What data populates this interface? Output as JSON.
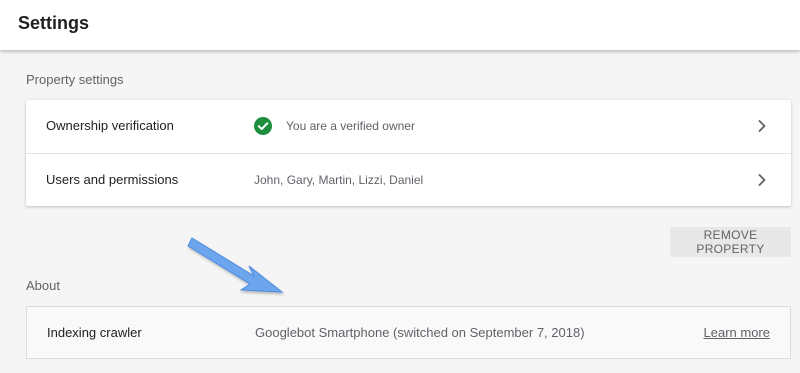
{
  "header": {
    "title": "Settings"
  },
  "property_settings": {
    "section_label": "Property settings",
    "rows": [
      {
        "title": "Ownership verification",
        "value": "You are a verified owner",
        "icon": "check-circle-icon",
        "icon_color": "#1e8e3e"
      },
      {
        "title": "Users and permissions",
        "value": "John, Gary, Martin, Lizzi, Daniel"
      }
    ],
    "remove_button_label": "REMOVE PROPERTY"
  },
  "about": {
    "section_label": "About",
    "row": {
      "title": "Indexing crawler",
      "value": "Googlebot Smartphone (switched on September 7, 2018)",
      "link": "Learn more"
    }
  },
  "annotation": {
    "icon": "arrow-icon",
    "color": "#6ea6ee"
  }
}
